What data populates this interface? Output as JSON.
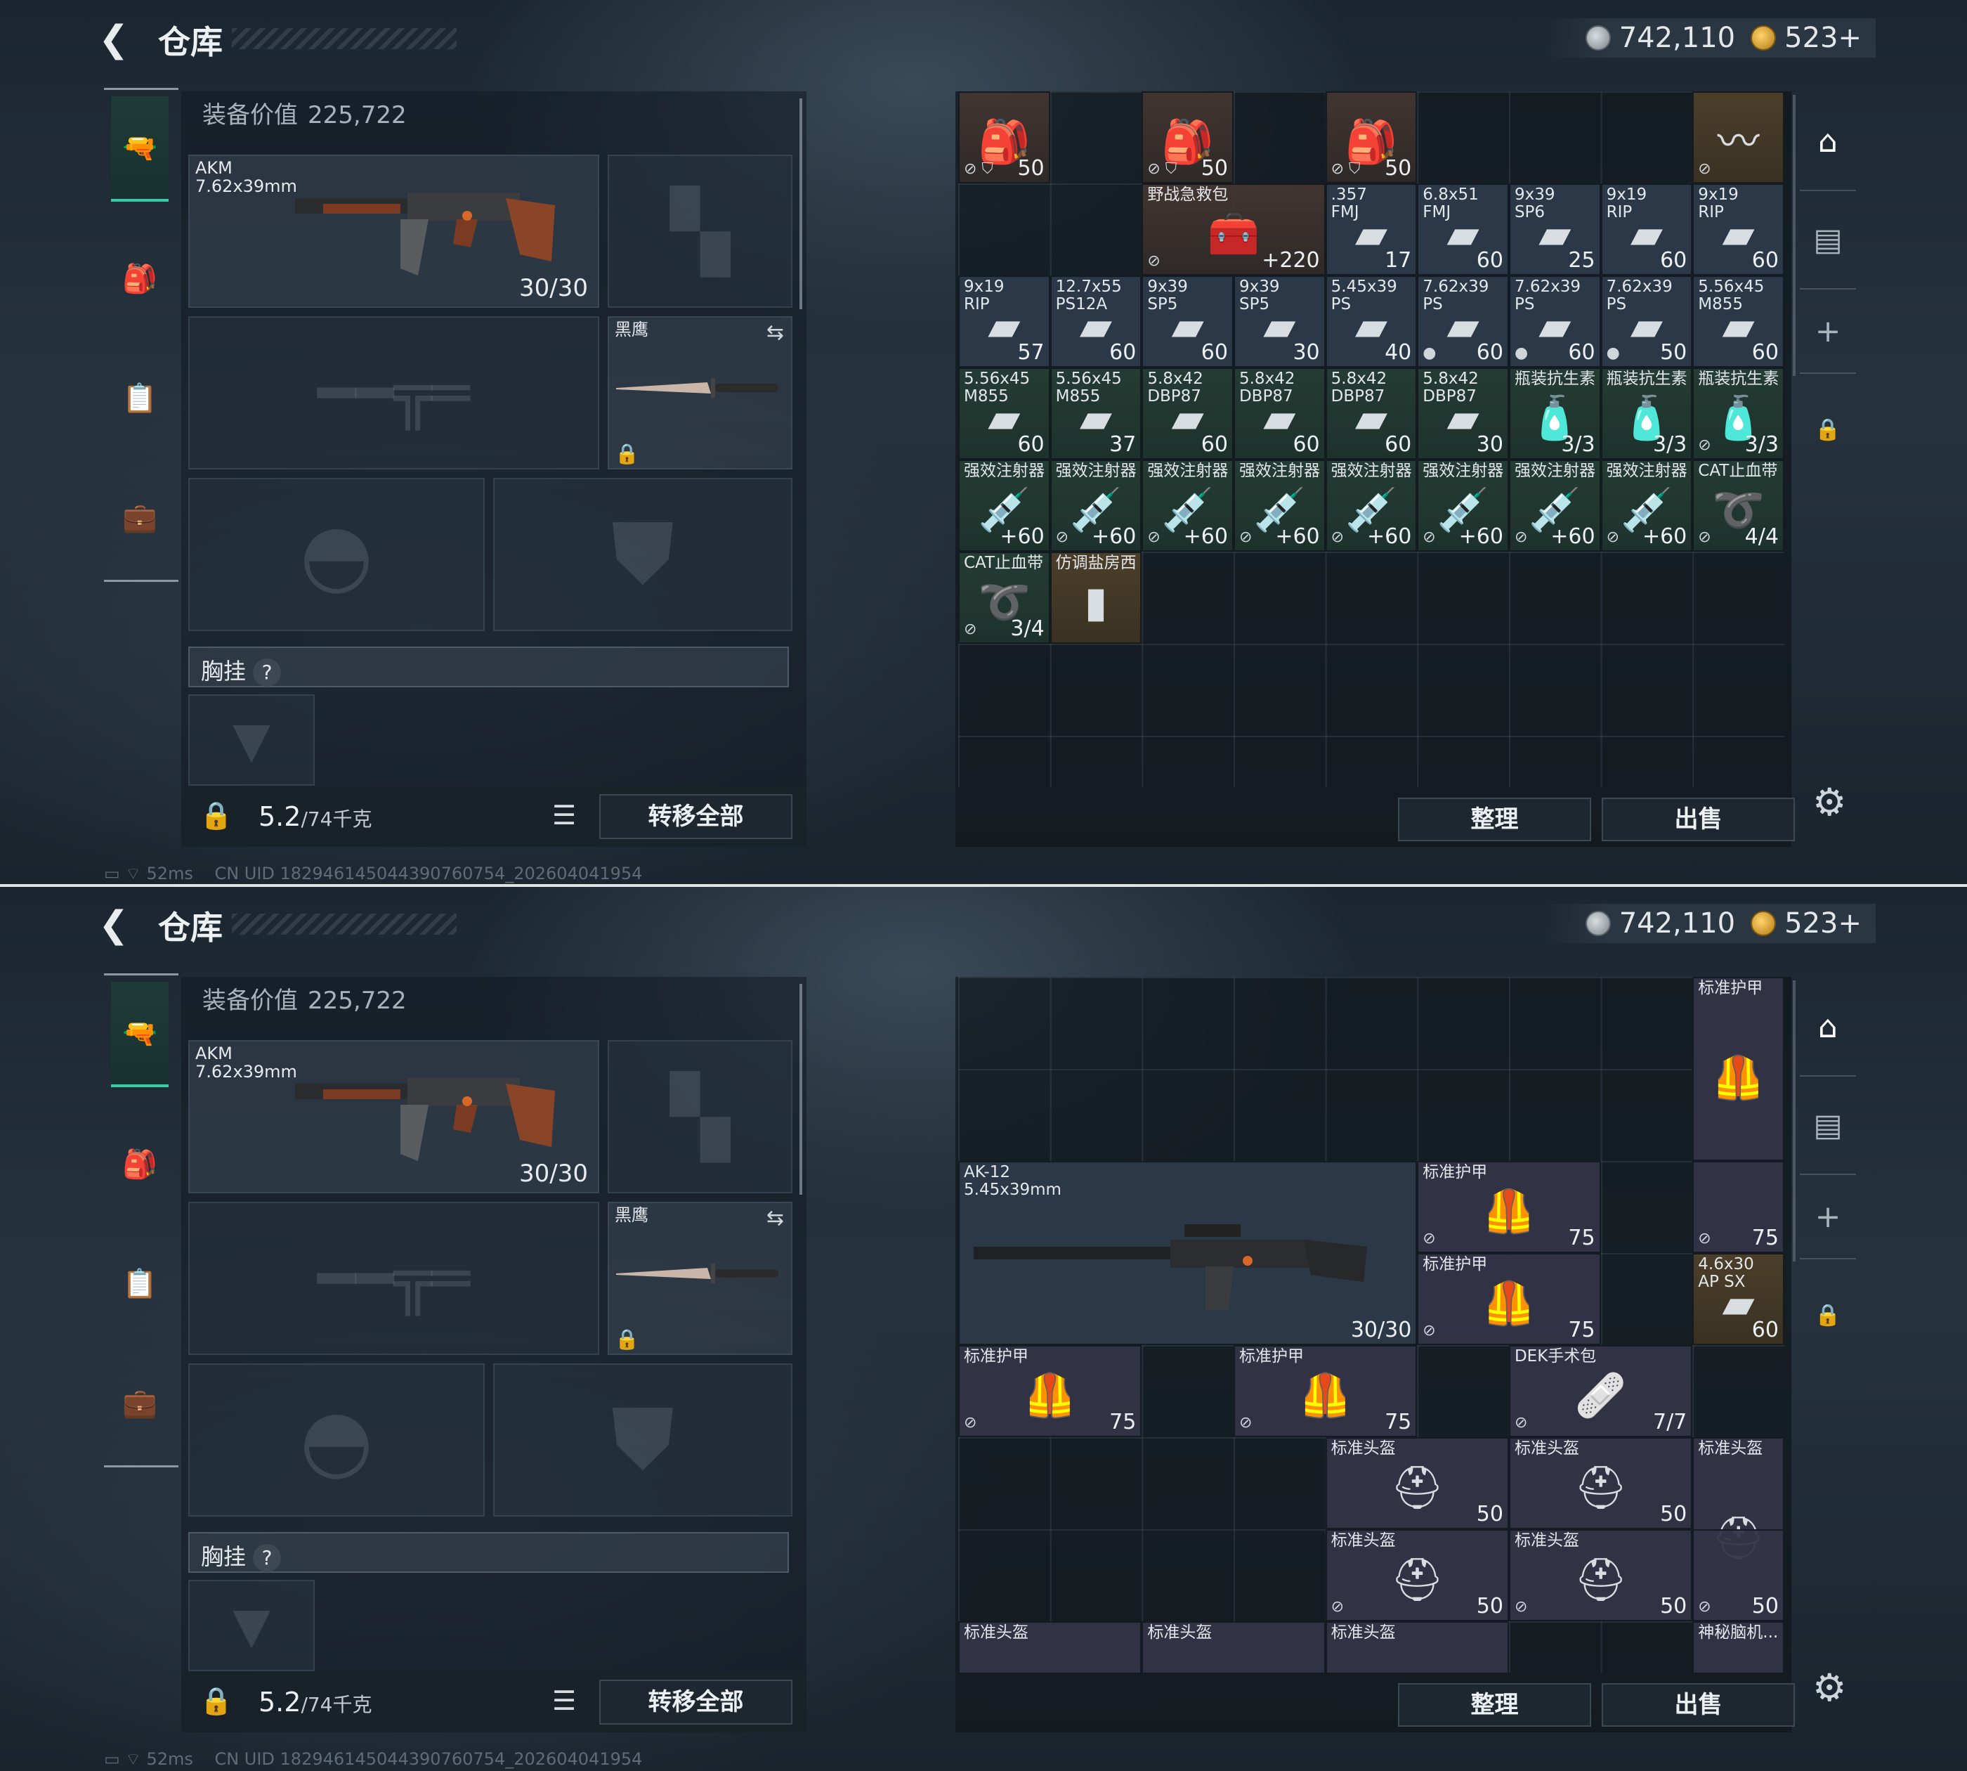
{
  "topbar": {
    "title": "仓库",
    "silver": "742,110",
    "gold": "523+"
  },
  "nav": {
    "tabs": [
      "weapons",
      "armor",
      "container",
      "case"
    ]
  },
  "equipment": {
    "value_label": "装备价值",
    "value": "225,722",
    "primary": {
      "name": "AKM",
      "caliber": "7.62x39mm",
      "ammo": "30/30"
    },
    "melee": {
      "name": "黑鹰"
    },
    "chest_label": "胸挂",
    "weight": "5.2",
    "weight_max": "/74千克",
    "transfer": "转移全部"
  },
  "status": {
    "ping": "52ms",
    "uid": "CN UID 182946145044390760754_202604041954"
  },
  "stash_buttons": {
    "organize": "整理",
    "sell": "出售"
  },
  "stash1": [
    {
      "n": "",
      "c": "50",
      "k": "red",
      "art": "🎒",
      "fl": "⊘ ⛉"
    },
    {
      "n": "",
      "c": "50",
      "k": "red",
      "art": "🎒",
      "fl": "⊘ ⛉"
    },
    {
      "n": "",
      "c": "50",
      "k": "red",
      "art": "🎒",
      "fl": "⊘ ⛉"
    },
    {
      "n": "",
      "c": "",
      "k": "gold",
      "art": "〰",
      "fl": "⊘"
    },
    {
      "n": "野战急救包",
      "c": "+220",
      "k": "red",
      "art": "🧰",
      "fl": "⊘"
    },
    {
      "n": ".357\nFMJ",
      "c": "17",
      "k": "blue",
      "art": "▰",
      "fl": ""
    },
    {
      "n": "6.8x51\nFMJ",
      "c": "60",
      "k": "blue",
      "art": "▰",
      "fl": ""
    },
    {
      "n": "9x39\nSP6",
      "c": "25",
      "k": "blue",
      "art": "▰",
      "fl": ""
    },
    {
      "n": "9x19\nRIP",
      "c": "60",
      "k": "blue",
      "art": "▰",
      "fl": ""
    },
    {
      "n": "9x19\nRIP",
      "c": "60",
      "k": "blue",
      "art": "▰",
      "fl": ""
    },
    {
      "n": "9x19\nRIP",
      "c": "57",
      "k": "blue",
      "art": "▰",
      "fl": ""
    },
    {
      "n": "12.7x55\nPS12A",
      "c": "60",
      "k": "blue",
      "art": "▰",
      "fl": ""
    },
    {
      "n": "9x39\nSP5",
      "c": "60",
      "k": "blue",
      "art": "▰",
      "fl": ""
    },
    {
      "n": "9x39\nSP5",
      "c": "30",
      "k": "blue",
      "art": "▰",
      "fl": ""
    },
    {
      "n": "5.45x39\nPS",
      "c": "40",
      "k": "blue",
      "art": "▰",
      "fl": ""
    },
    {
      "n": "7.62x39\nPS",
      "c": "60",
      "k": "blue",
      "art": "▰",
      "fl": "●"
    },
    {
      "n": "7.62x39\nPS",
      "c": "60",
      "k": "blue",
      "art": "▰",
      "fl": "●"
    },
    {
      "n": "7.62x39\nPS",
      "c": "50",
      "k": "blue",
      "art": "▰",
      "fl": "●"
    },
    {
      "n": "5.56x45\nM855",
      "c": "60",
      "k": "blue",
      "art": "▰",
      "fl": ""
    },
    {
      "n": "5.56x45\nM855",
      "c": "60",
      "k": "grn",
      "art": "▰",
      "fl": ""
    },
    {
      "n": "5.56x45\nM855",
      "c": "37",
      "k": "grn",
      "art": "▰",
      "fl": ""
    },
    {
      "n": "5.8x42\nDBP87",
      "c": "60",
      "k": "grn",
      "art": "▰",
      "fl": ""
    },
    {
      "n": "5.8x42\nDBP87",
      "c": "60",
      "k": "grn",
      "art": "▰",
      "fl": ""
    },
    {
      "n": "5.8x42\nDBP87",
      "c": "60",
      "k": "grn",
      "art": "▰",
      "fl": ""
    },
    {
      "n": "5.8x42\nDBP87",
      "c": "30",
      "k": "grn",
      "art": "▰",
      "fl": ""
    },
    {
      "n": "瓶装抗生素",
      "c": "3/3",
      "k": "grn",
      "art": "🧴",
      "fl": ""
    },
    {
      "n": "瓶装抗生素",
      "c": "3/3",
      "k": "grn",
      "art": "🧴",
      "fl": ""
    },
    {
      "n": "瓶装抗生素",
      "c": "3/3",
      "k": "grn",
      "art": "🧴",
      "fl": "⊘"
    },
    {
      "n": "强效注射器",
      "c": "+60",
      "k": "grn",
      "art": "💉",
      "fl": ""
    },
    {
      "n": "强效注射器",
      "c": "+60",
      "k": "grn",
      "art": "💉",
      "fl": "⊘"
    },
    {
      "n": "强效注射器",
      "c": "+60",
      "k": "grn",
      "art": "💉",
      "fl": "⊘"
    },
    {
      "n": "强效注射器",
      "c": "+60",
      "k": "grn",
      "art": "💉",
      "fl": "⊘"
    },
    {
      "n": "强效注射器",
      "c": "+60",
      "k": "grn",
      "art": "💉",
      "fl": "⊘"
    },
    {
      "n": "强效注射器",
      "c": "+60",
      "k": "grn",
      "art": "💉",
      "fl": "⊘"
    },
    {
      "n": "强效注射器",
      "c": "+60",
      "k": "grn",
      "art": "💉",
      "fl": "⊘"
    },
    {
      "n": "强效注射器",
      "c": "+60",
      "k": "grn",
      "art": "💉",
      "fl": "⊘"
    },
    {
      "n": "CAT止血带",
      "c": "4/4",
      "k": "grn",
      "art": "➰",
      "fl": "⊘"
    },
    {
      "n": "CAT止血带",
      "c": "3/4",
      "k": "grn",
      "art": "➰",
      "fl": "⊘"
    },
    {
      "n": "仿调盐房西",
      "c": "",
      "k": "gold",
      "art": "▮",
      "fl": ""
    }
  ],
  "stash2": [
    {
      "n": "标准护甲",
      "c": "",
      "k": "purple",
      "art": "🦺",
      "fl": ""
    },
    {
      "n": "AK-12\n5.45x39mm",
      "c": "30/30",
      "k": "blue",
      "art": "",
      "fl": ""
    },
    {
      "n": "标准护甲",
      "c": "75",
      "k": "purple",
      "art": "🦺",
      "fl": "⊘"
    },
    {
      "n": "",
      "c": "75",
      "k": "purple",
      "art": "",
      "fl": "⊘"
    },
    {
      "n": "标准护甲",
      "c": "75",
      "k": "purple",
      "art": "🦺",
      "fl": "⊘"
    },
    {
      "n": "4.6x30\nAP SX",
      "c": "60",
      "k": "gold",
      "art": "▰",
      "fl": ""
    },
    {
      "n": "标准护甲",
      "c": "75",
      "k": "purple",
      "art": "🦺",
      "fl": "⊘"
    },
    {
      "n": "标准护甲",
      "c": "75",
      "k": "purple",
      "art": "🦺",
      "fl": "⊘"
    },
    {
      "n": "DEK手术包",
      "c": "7/7",
      "k": "purple",
      "art": "🩹",
      "fl": "⊘"
    },
    {
      "n": "标准头盔",
      "c": "50",
      "k": "purple",
      "art": "⛑",
      "fl": ""
    },
    {
      "n": "标准头盔",
      "c": "50",
      "k": "purple",
      "art": "⛑",
      "fl": ""
    },
    {
      "n": "标准头盔",
      "c": "",
      "k": "purple",
      "art": "⛑",
      "fl": ""
    },
    {
      "n": "标准头盔",
      "c": "50",
      "k": "purple",
      "art": "⛑",
      "fl": "⊘"
    },
    {
      "n": "标准头盔",
      "c": "50",
      "k": "purple",
      "art": "⛑",
      "fl": "⊘"
    },
    {
      "n": "",
      "c": "50",
      "k": "purple",
      "art": "",
      "fl": "⊘"
    },
    {
      "n": "标准头盔",
      "c": "",
      "k": "purple",
      "art": "",
      "fl": ""
    },
    {
      "n": "标准头盔",
      "c": "",
      "k": "purple",
      "art": "",
      "fl": ""
    },
    {
      "n": "标准头盔",
      "c": "",
      "k": "purple",
      "art": "",
      "fl": ""
    },
    {
      "n": "神秘脑机...",
      "c": "",
      "k": "purple",
      "art": "",
      "fl": ""
    }
  ]
}
